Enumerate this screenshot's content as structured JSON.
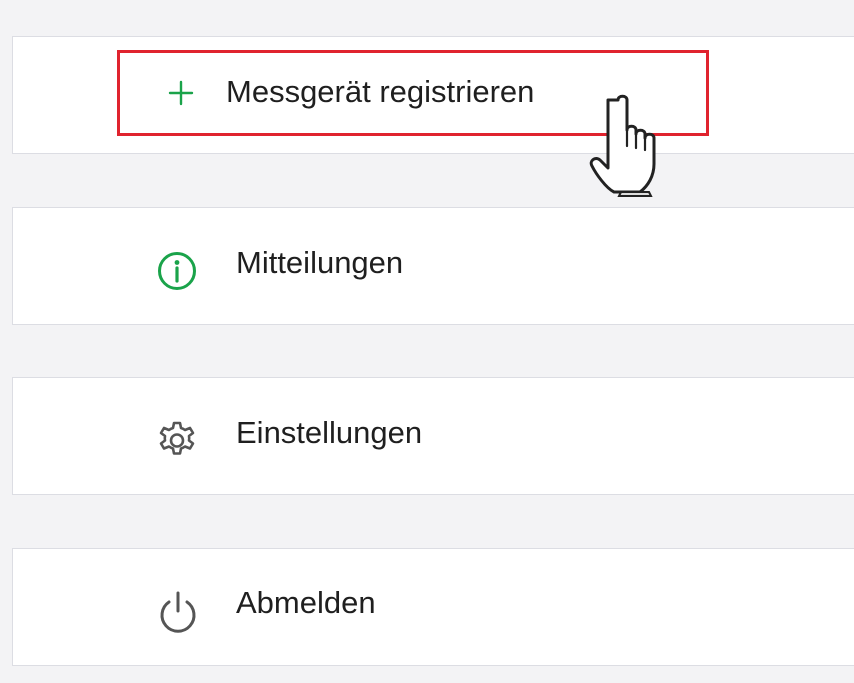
{
  "menu": {
    "items": [
      {
        "label": "Messgerät registrieren",
        "icon": "plus-icon"
      },
      {
        "label": "Mitteilungen",
        "icon": "info-icon"
      },
      {
        "label": "Einstellungen",
        "icon": "gear-icon"
      },
      {
        "label": "Abmelden",
        "icon": "power-icon"
      }
    ]
  },
  "colors": {
    "accent_green": "#1aa34a",
    "highlight_red": "#e0232e",
    "icon_gray": "#555555",
    "background": "#f3f3f5"
  },
  "cursor": {
    "icon": "hand-pointer-icon"
  }
}
